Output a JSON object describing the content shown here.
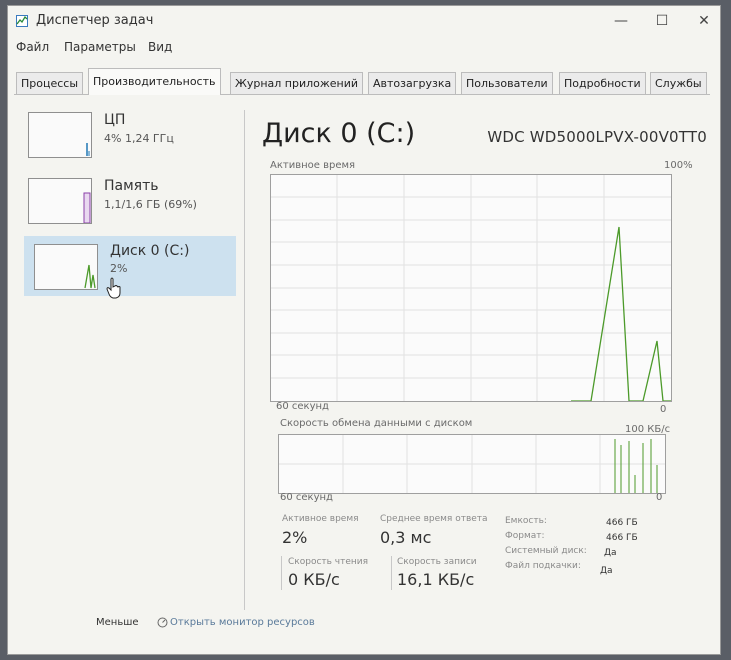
{
  "window": {
    "title": "Диспетчер задач"
  },
  "menu": [
    "Файл",
    "Параметры",
    "Вид"
  ],
  "tabs": [
    {
      "label": "Процессы"
    },
    {
      "label": "Производительность"
    },
    {
      "label": "Журнал приложений"
    },
    {
      "label": "Автозагрузка"
    },
    {
      "label": "Пользователи"
    },
    {
      "label": "Подробности"
    },
    {
      "label": "Службы"
    }
  ],
  "active_tab": "Производительность",
  "sidebar": {
    "items": [
      {
        "title": "ЦП",
        "subtitle": "4% 1,24 ГГц"
      },
      {
        "title": "Память",
        "subtitle": "1,1/1,6 ГБ (69%)"
      },
      {
        "title": "Диск 0 (C:)",
        "subtitle": "2%"
      }
    ],
    "selected": "Диск 0 (C:)"
  },
  "main": {
    "title": "Диск 0 (C:)",
    "model": "WDC WD5000LPVX-00V0TT0",
    "active_time_label": "Активное время",
    "active_time_max": "100%",
    "time_label": "60 секунд",
    "zero_label": "0",
    "transfer_label": "Скорость обмена данными с диском",
    "transfer_max": "100 КБ/с",
    "time_label2": "60 секунд",
    "zero_label2": "0"
  },
  "stats": {
    "active_time": {
      "label": "Активное время",
      "value": "2%"
    },
    "avg_response": {
      "label": "Среднее время ответа",
      "value": "0,3 мс"
    },
    "read_speed": {
      "label": "Скорость чтения",
      "value": "0 КБ/с"
    },
    "write_speed": {
      "label": "Скорость записи",
      "value": "16,1 КБ/с"
    }
  },
  "properties": [
    {
      "label": "Емкость:",
      "value": "466 ГБ"
    },
    {
      "label": "Формат:",
      "value": "466 ГБ"
    },
    {
      "label": "Системный диск:",
      "value": "Да"
    },
    {
      "label": "Файл подкачки:",
      "value": "Да"
    }
  ],
  "footer": {
    "less": "Меньше",
    "open_monitor": "Открыть монитор ресурсов"
  },
  "colors": {
    "accent_select": "#cde1ef",
    "disk_green": "#4c9a2a",
    "cpu_blue": "#1f77b4",
    "mem_purple": "#8b3fa8"
  }
}
